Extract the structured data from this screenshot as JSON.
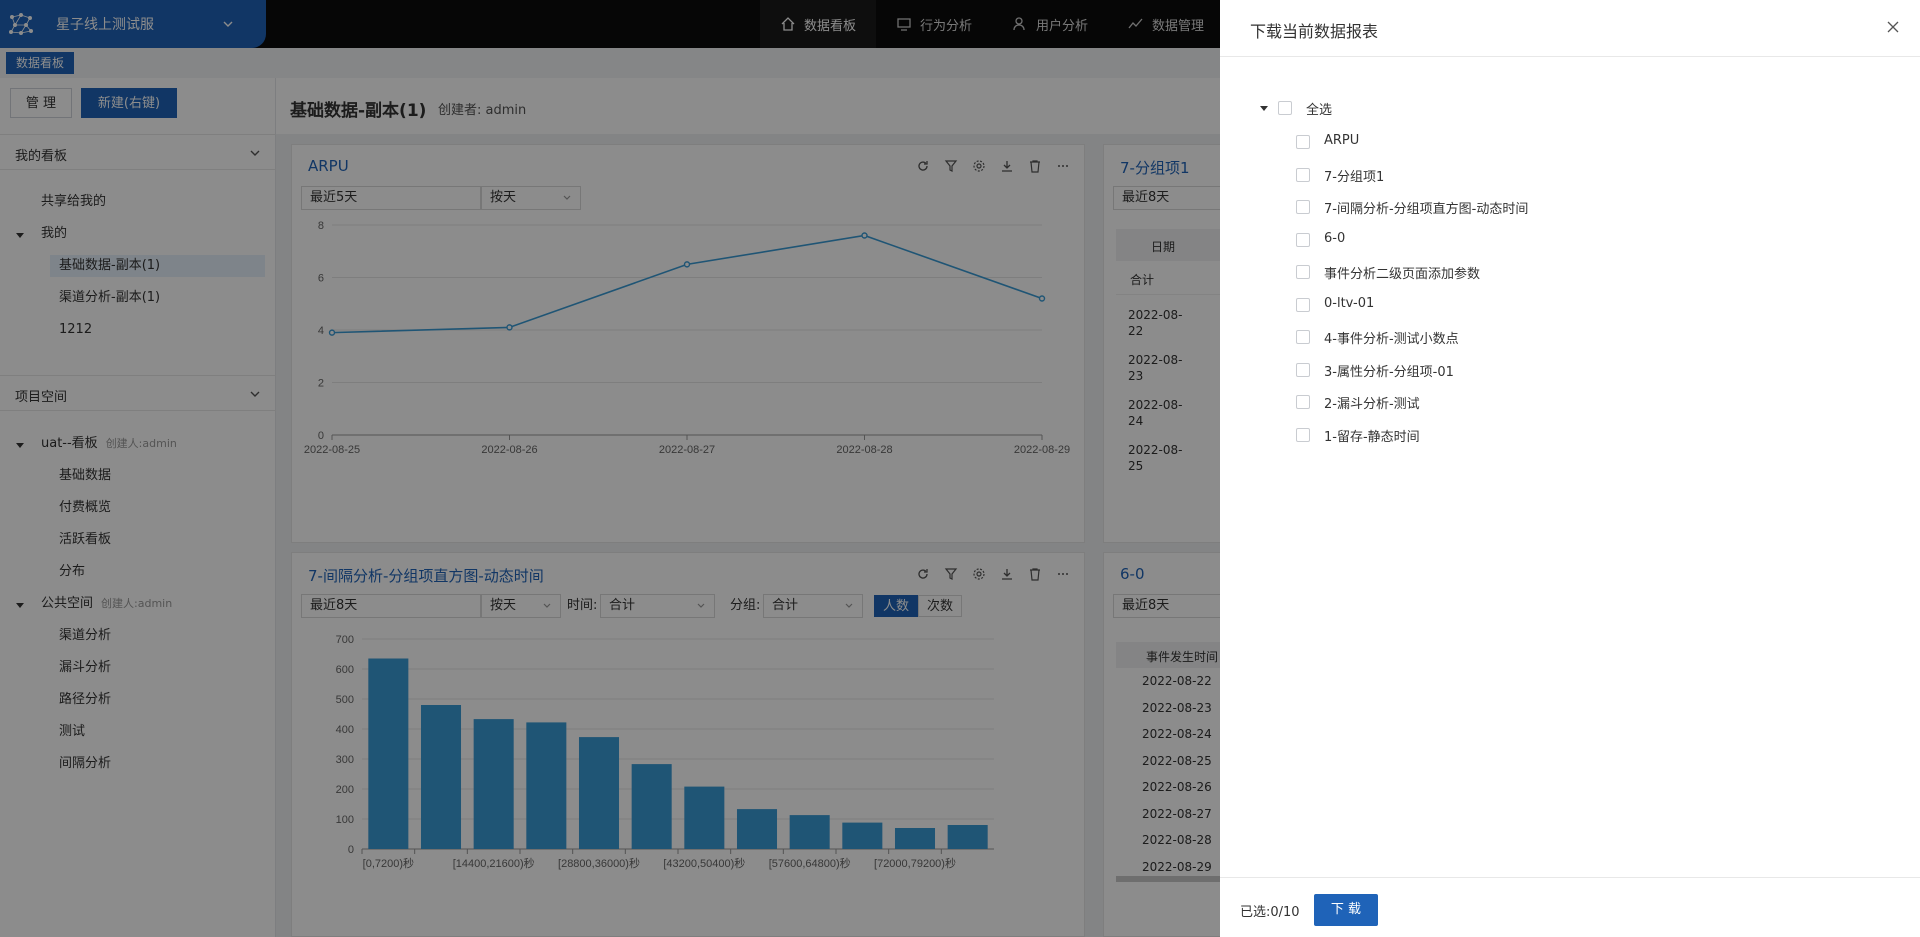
{
  "brand": {
    "title": "星子线上测试服"
  },
  "nav": [
    {
      "label": "数据看板",
      "icon": "home-icon"
    },
    {
      "label": "行为分析",
      "icon": "monitor-icon"
    },
    {
      "label": "用户分析",
      "icon": "user-icon"
    },
    {
      "label": "数据管理",
      "icon": "trend-icon"
    }
  ],
  "tab_chip": "数据看板",
  "sidebar": {
    "manage_label": "管 理",
    "new_label": "新建(右键)",
    "my_boards": {
      "heading": "我的看板",
      "shared": "共享给我的",
      "mine": "我的",
      "items": [
        "基础数据-副本(1)",
        "渠道分析-副本(1)",
        "1212"
      ]
    },
    "project_space": {
      "heading": "项目空间",
      "group1": {
        "label": "uat--看板",
        "creator": "创建人:admin",
        "items": [
          "基础数据",
          "付费概览",
          "活跃看板",
          "分布"
        ]
      },
      "group2": {
        "label": "公共空间",
        "creator": "创建人:admin",
        "items": [
          "渠道分析",
          "漏斗分析",
          "路径分析",
          "测试",
          "间隔分析"
        ]
      }
    }
  },
  "board": {
    "title": "基础数据-副本(1)",
    "creator": "创建者: admin"
  },
  "cards": {
    "arpu": {
      "title": "ARPU",
      "range": "最近5天",
      "granularity": "按天"
    },
    "interval": {
      "title": "7-间隔分析-分组项直方图-动态时间",
      "range": "最近8天",
      "granularity": "按天",
      "time_label": "时间:",
      "time_value": "合计",
      "group_label": "分组:",
      "group_value": "合计",
      "toggle_people": "人数",
      "toggle_times": "次数"
    },
    "group1": {
      "title": "7-分组项1",
      "range": "最近8天",
      "col_date": "日期",
      "total": "合计",
      "rows": [
        "2022-08-\n22",
        "2022-08-\n23",
        "2022-08-\n24",
        "2022-08-\n25"
      ]
    },
    "six": {
      "title": "6-0",
      "range": "最近8天",
      "col": "事件发生时间",
      "rows": [
        "2022-08-22",
        "2022-08-23",
        "2022-08-24",
        "2022-08-25",
        "2022-08-26",
        "2022-08-27",
        "2022-08-28",
        "2022-08-29"
      ]
    }
  },
  "chart_data": [
    {
      "type": "line",
      "x": [
        "2022-08-25",
        "2022-08-26",
        "2022-08-27",
        "2022-08-28",
        "2022-08-29"
      ],
      "values": [
        3.9,
        4.1,
        6.5,
        7.6,
        5.2
      ],
      "ylim": [
        0,
        8
      ],
      "yticks": [
        0,
        2,
        4,
        6,
        8
      ],
      "color": "#3a9bd5"
    },
    {
      "type": "bar",
      "categories": [
        "[0,7200)秒",
        "",
        "[14400,21600)秒",
        "",
        "[28800,36000)秒",
        "",
        "[43200,50400)秒",
        "",
        "[57600,64800)秒",
        "",
        "[72000,79200)秒",
        ""
      ],
      "values": [
        635,
        480,
        433,
        422,
        373,
        283,
        208,
        133,
        113,
        88,
        70,
        80
      ],
      "ylim": [
        0,
        700
      ],
      "yticks": [
        0,
        100,
        200,
        300,
        400,
        500,
        600,
        700
      ],
      "color": "#3a9bd5"
    }
  ],
  "drawer": {
    "title": "下载当前数据报表",
    "select_all": "全选",
    "items": [
      "ARPU",
      "7-分组项1",
      "7-间隔分析-分组项直方图-动态时间",
      "6-0",
      "事件分析二级页面添加参数",
      "0-ltv-01",
      "4-事件分析-测试小数点",
      "3-属性分析-分组项-01",
      "2-漏斗分析-测试",
      "1-留存-静态时间"
    ],
    "selected_count": "已选:0/10",
    "download_label": "下 载"
  }
}
